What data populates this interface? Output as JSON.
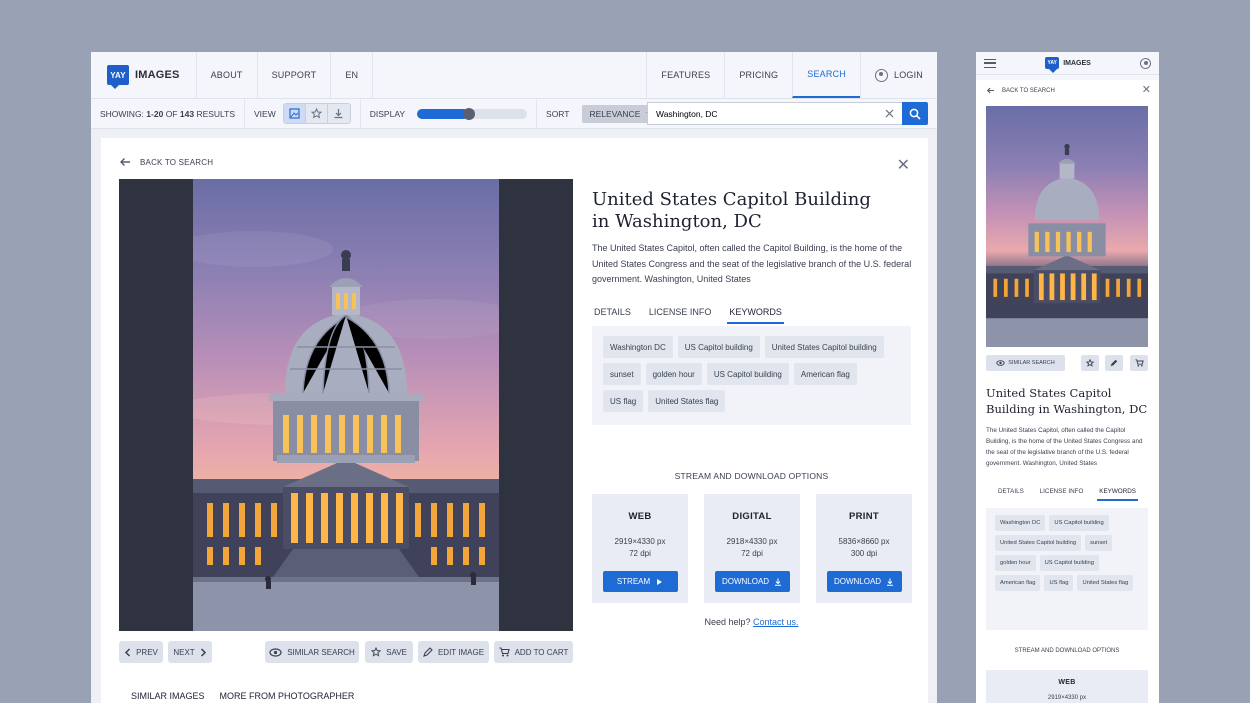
{
  "brand": {
    "badge": "YAY",
    "name": "IMAGES"
  },
  "nav": {
    "left": [
      "ABOUT",
      "SUPPORT",
      "EN"
    ],
    "right": [
      "FEATURES",
      "PRICING",
      "SEARCH"
    ],
    "login": "LOGIN"
  },
  "toolbar": {
    "showing_prefix": "SHOWING:",
    "showing_range": "1-20",
    "showing_of": "OF",
    "showing_total": "143",
    "showing_suffix": "RESULTS",
    "view_label": "VIEW",
    "display_label": "DISPLAY",
    "display_level": 0.47,
    "sort_label": "SORT",
    "sort_value": "RELEVANCE"
  },
  "search": {
    "value": "Washington, DC"
  },
  "detail": {
    "back": "BACK TO SEARCH",
    "title": "United States Capitol Building in Washington, DC",
    "description": "The United States Capitol, often called the Capitol Building, is the home of the United States Congress and the seat of the legislative branch of the U.S. federal government. Washington, United States",
    "tabs": [
      "DETAILS",
      "LICENSE INFO",
      "KEYWORDS"
    ],
    "keywords": [
      "Washington DC",
      "US Capitol building",
      "United States Capitol building",
      "sunset",
      "golden hour",
      "US Capitol building",
      "American flag",
      "US flag",
      "United States flag"
    ],
    "stream_heading": "STREAM AND DOWNLOAD OPTIONS",
    "options": [
      {
        "name": "WEB",
        "size": "2919×4330 px",
        "dpi": "72 dpi",
        "button": "STREAM"
      },
      {
        "name": "DIGITAL",
        "size": "2918×4330 px",
        "dpi": "72 dpi",
        "button": "DOWNLOAD"
      },
      {
        "name": "PRINT",
        "size": "5836×8660 px",
        "dpi": "300 dpi",
        "button": "DOWNLOAD"
      }
    ],
    "help_text": "Need help?",
    "help_link": "Contact us.",
    "actions": {
      "prev": "PREV",
      "next": "NEXT",
      "similar": "SIMILAR SEARCH",
      "save": "SAVE",
      "edit": "EDIT IMAGE",
      "cart": "ADD TO CART"
    },
    "bottom_tabs": [
      "SIMILAR IMAGES",
      "MORE FROM PHOTOGRAPHER"
    ]
  },
  "mobile": {
    "back": "BACK TO SEARCH",
    "similar": "SIMILAR SEARCH",
    "title": "United States Capitol Building in Washington, DC",
    "description": "The United States Capitol, often called the Capitol Building, is the home of the United States Congress and the seat of the legislative branch of the U.S. federal government. Washington, United States",
    "tabs": [
      "DETAILS",
      "LICENSE INFO",
      "KEYWORDS"
    ],
    "keywords": [
      "Washington DC",
      "US Capitol building",
      "United States Capitol building",
      "sunset",
      "golden hour",
      "US Capitol building",
      "American flag",
      "US flag",
      "United States flag"
    ],
    "stream_heading": "STREAM AND DOWNLOAD OPTIONS",
    "card_name": "WEB",
    "card_size": "2919×4330 px"
  },
  "colors": {
    "accent": "#1f6bd6",
    "background": "#99a1b5"
  }
}
